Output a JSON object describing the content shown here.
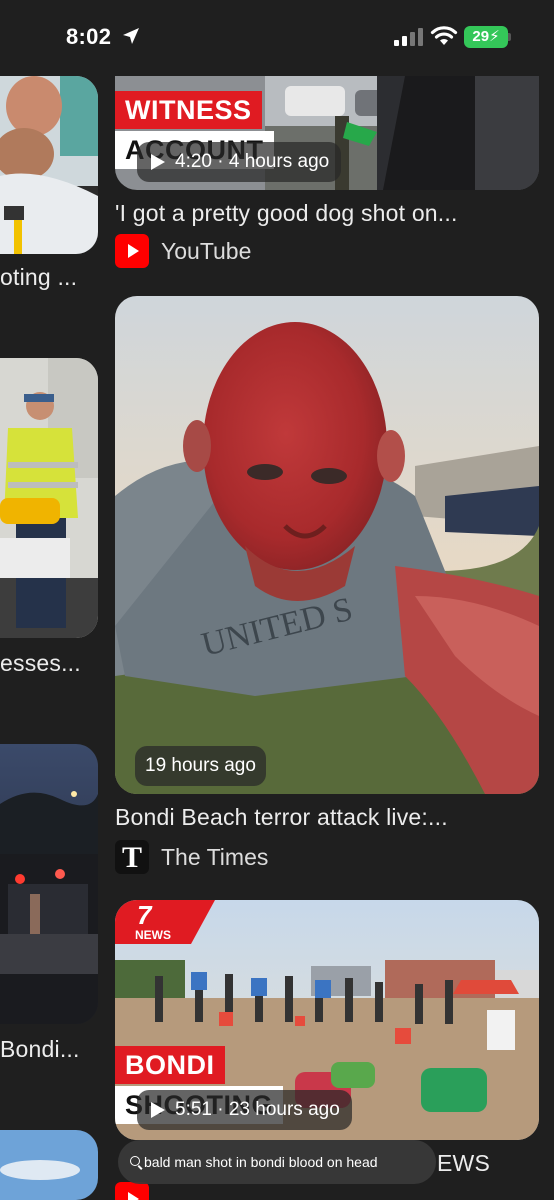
{
  "status_bar": {
    "time": "8:02",
    "battery": "29"
  },
  "left_column": [
    {
      "title_fragment": "oting ..."
    },
    {
      "title_fragment": "esses..."
    },
    {
      "title_fragment": "Bondi..."
    }
  ],
  "results": [
    {
      "banner_top": "WITNESS",
      "banner_bottom": "ACCOUNT",
      "duration": "4:20 · 4 hours ago",
      "title": "'I got a pretty good dog shot on...",
      "source": "YouTube",
      "source_icon": "youtube-icon"
    },
    {
      "timestamp": "19 hours ago",
      "title": "Bondi Beach terror attack live:...",
      "source": "The Times",
      "source_icon": "the-times-icon",
      "source_logo_letter": "T"
    },
    {
      "channel_logo": "7 NEWS",
      "banner_top": "BONDI",
      "banner_bottom": "SHOOTING",
      "duration": "5:51 · 23 hours ago",
      "title_fragment": "EWS",
      "source": "YouTube",
      "source_icon": "youtube-icon"
    }
  ],
  "search": {
    "query": "bald man shot in bondi blood on head"
  },
  "colors": {
    "background": "#1f1f1f",
    "youtube_red": "#ff0000",
    "banner_red": "#e01b22",
    "battery_green": "#34c759"
  }
}
